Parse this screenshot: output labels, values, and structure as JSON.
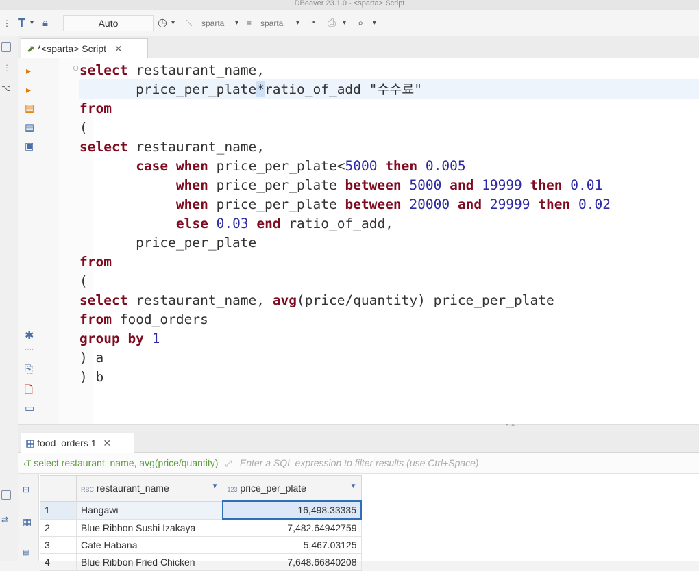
{
  "window": {
    "title": "DBeaver 23.1.0 - <sparta> Script"
  },
  "toolbar": {
    "commit_mode": "Auto",
    "datasource": "sparta",
    "schema": "sparta"
  },
  "editor": {
    "tab_label": "*<sparta> Script",
    "lines": [
      [
        {
          "t": "select",
          "c": "kw"
        },
        {
          "t": " restaurant_name,",
          "c": "txt"
        }
      ],
      [
        {
          "t": "       price_per_plate",
          "c": "txt"
        },
        {
          "t": "*",
          "c": "cursor"
        },
        {
          "t": "ratio_of_add ",
          "c": "txt"
        },
        {
          "t": "\"수수료\"",
          "c": "str"
        }
      ],
      [
        {
          "t": "from",
          "c": "kw"
        }
      ],
      [
        {
          "t": "(",
          "c": "txt"
        }
      ],
      [
        {
          "t": "select",
          "c": "kw"
        },
        {
          "t": " restaurant_name,",
          "c": "txt"
        }
      ],
      [
        {
          "t": "       ",
          "c": "txt"
        },
        {
          "t": "case",
          "c": "kw"
        },
        {
          "t": " ",
          "c": "txt"
        },
        {
          "t": "when",
          "c": "kw"
        },
        {
          "t": " price_per_plate<",
          "c": "txt"
        },
        {
          "t": "5000",
          "c": "num"
        },
        {
          "t": " ",
          "c": "txt"
        },
        {
          "t": "then",
          "c": "kw"
        },
        {
          "t": " ",
          "c": "txt"
        },
        {
          "t": "0.005",
          "c": "num"
        }
      ],
      [
        {
          "t": "            ",
          "c": "txt"
        },
        {
          "t": "when",
          "c": "kw"
        },
        {
          "t": " price_per_plate ",
          "c": "txt"
        },
        {
          "t": "between",
          "c": "kw"
        },
        {
          "t": " ",
          "c": "txt"
        },
        {
          "t": "5000",
          "c": "num"
        },
        {
          "t": " ",
          "c": "txt"
        },
        {
          "t": "and",
          "c": "kw"
        },
        {
          "t": " ",
          "c": "txt"
        },
        {
          "t": "19999",
          "c": "num"
        },
        {
          "t": " ",
          "c": "txt"
        },
        {
          "t": "then",
          "c": "kw"
        },
        {
          "t": " ",
          "c": "txt"
        },
        {
          "t": "0.01",
          "c": "num"
        }
      ],
      [
        {
          "t": "            ",
          "c": "txt"
        },
        {
          "t": "when",
          "c": "kw"
        },
        {
          "t": " price_per_plate ",
          "c": "txt"
        },
        {
          "t": "between",
          "c": "kw"
        },
        {
          "t": " ",
          "c": "txt"
        },
        {
          "t": "20000",
          "c": "num"
        },
        {
          "t": " ",
          "c": "txt"
        },
        {
          "t": "and",
          "c": "kw"
        },
        {
          "t": " ",
          "c": "txt"
        },
        {
          "t": "29999",
          "c": "num"
        },
        {
          "t": " ",
          "c": "txt"
        },
        {
          "t": "then",
          "c": "kw"
        },
        {
          "t": " ",
          "c": "txt"
        },
        {
          "t": "0.02",
          "c": "num"
        }
      ],
      [
        {
          "t": "            ",
          "c": "txt"
        },
        {
          "t": "else",
          "c": "kw"
        },
        {
          "t": " ",
          "c": "txt"
        },
        {
          "t": "0.03",
          "c": "num"
        },
        {
          "t": " ",
          "c": "txt"
        },
        {
          "t": "end",
          "c": "kw"
        },
        {
          "t": " ratio_of_add,",
          "c": "txt"
        }
      ],
      [
        {
          "t": "       price_per_plate",
          "c": "txt"
        }
      ],
      [
        {
          "t": "from",
          "c": "kw"
        }
      ],
      [
        {
          "t": "(",
          "c": "txt"
        }
      ],
      [
        {
          "t": "select",
          "c": "kw"
        },
        {
          "t": " restaurant_name, ",
          "c": "txt"
        },
        {
          "t": "avg",
          "c": "kw"
        },
        {
          "t": "(price/quantity) price_per_plate",
          "c": "txt"
        }
      ],
      [
        {
          "t": "from",
          "c": "kw"
        },
        {
          "t": " food_orders",
          "c": "txt"
        }
      ],
      [
        {
          "t": "group by",
          "c": "kw"
        },
        {
          "t": " ",
          "c": "txt"
        },
        {
          "t": "1",
          "c": "num"
        }
      ],
      [
        {
          "t": ") a",
          "c": "txt"
        }
      ],
      [
        {
          "t": ") b",
          "c": "txt"
        }
      ]
    ]
  },
  "results": {
    "tab_label": "food_orders 1",
    "query_label": "select restaurant_name, avg(price/quantity)",
    "filter_placeholder": "Enter a SQL expression to filter results (use Ctrl+Space)",
    "columns": [
      {
        "label": "restaurant_name",
        "type_badge": "RBC"
      },
      {
        "label": "price_per_plate",
        "type_badge": "123"
      }
    ],
    "rows": [
      {
        "n": "1",
        "name": "Hangawi",
        "value": "16,498.33335"
      },
      {
        "n": "2",
        "name": "Blue Ribbon Sushi Izakaya",
        "value": "7,482.64942759"
      },
      {
        "n": "3",
        "name": "Cafe Habana",
        "value": "5,467.03125"
      },
      {
        "n": "4",
        "name": "Blue Ribbon Fried Chicken",
        "value": "7,648.66840208"
      }
    ]
  }
}
